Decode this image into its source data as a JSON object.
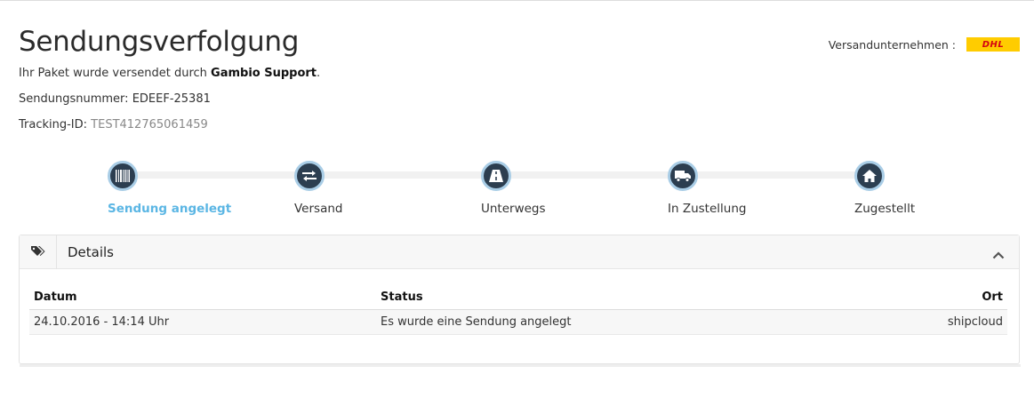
{
  "header": {
    "title": "Sendungsverfolgung",
    "intro_prefix": "Ihr Paket wurde versendet durch ",
    "intro_sender": "Gambio Support",
    "intro_suffix": ".",
    "shipment_label": "Sendungsnummer: ",
    "shipment_number": "EDEEF-25381",
    "tracking_label": "Tracking-ID: ",
    "tracking_id": "TEST412765061459"
  },
  "carrier": {
    "label": "Versandunternehmen :",
    "logo_text": "DHL",
    "logo_bg": "#ffcc00",
    "logo_fg": "#d40511"
  },
  "steps": [
    {
      "label": "Sendung angelegt",
      "icon": "barcode-icon",
      "active": true
    },
    {
      "label": "Versand",
      "icon": "exchange-icon",
      "active": false
    },
    {
      "label": "Unterwegs",
      "icon": "road-icon",
      "active": false
    },
    {
      "label": "In Zustellung",
      "icon": "truck-icon",
      "active": false
    },
    {
      "label": "Zugestellt",
      "icon": "home-icon",
      "active": false
    }
  ],
  "details": {
    "title": "Details",
    "columns": {
      "date": "Datum",
      "status": "Status",
      "location": "Ort"
    },
    "rows": [
      {
        "date": "24.10.2016 - 14:14 Uhr",
        "status": "Es wurde eine Sendung angelegt",
        "location": "shipcloud"
      }
    ]
  },
  "colors": {
    "active_step": "#5bb6e4",
    "step_dot": "#2c3e50",
    "step_ring": "#a9cde6"
  }
}
